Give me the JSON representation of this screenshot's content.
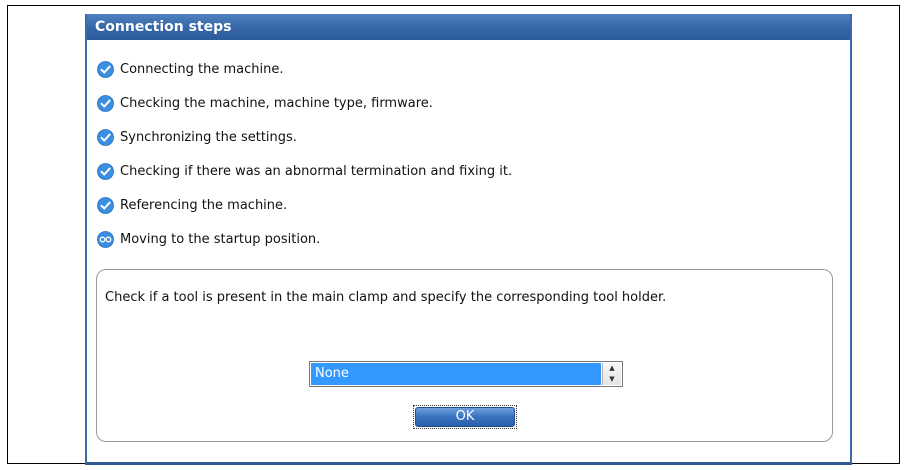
{
  "dialog": {
    "title": "Connection steps"
  },
  "steps": [
    {
      "label": "Connecting the machine.",
      "status": "done"
    },
    {
      "label": "Checking the machine, machine type, firmware.",
      "status": "done"
    },
    {
      "label": "Synchronizing the settings.",
      "status": "done"
    },
    {
      "label": "Checking if there was an abnormal termination and fixing it.",
      "status": "done"
    },
    {
      "label": "Referencing the machine.",
      "status": "done"
    },
    {
      "label": "Moving to the startup position.",
      "status": "in-progress"
    }
  ],
  "tool_panel": {
    "message": "Check if a tool is present in the main clamp and specify the corresponding tool holder.",
    "tool_holder_value": "None",
    "ok_label": "OK"
  },
  "colors": {
    "title_bar": "#3566a8",
    "check_icon": "#3b8fe0",
    "selection": "#3399ff",
    "ok_button": "#3a72c0"
  }
}
